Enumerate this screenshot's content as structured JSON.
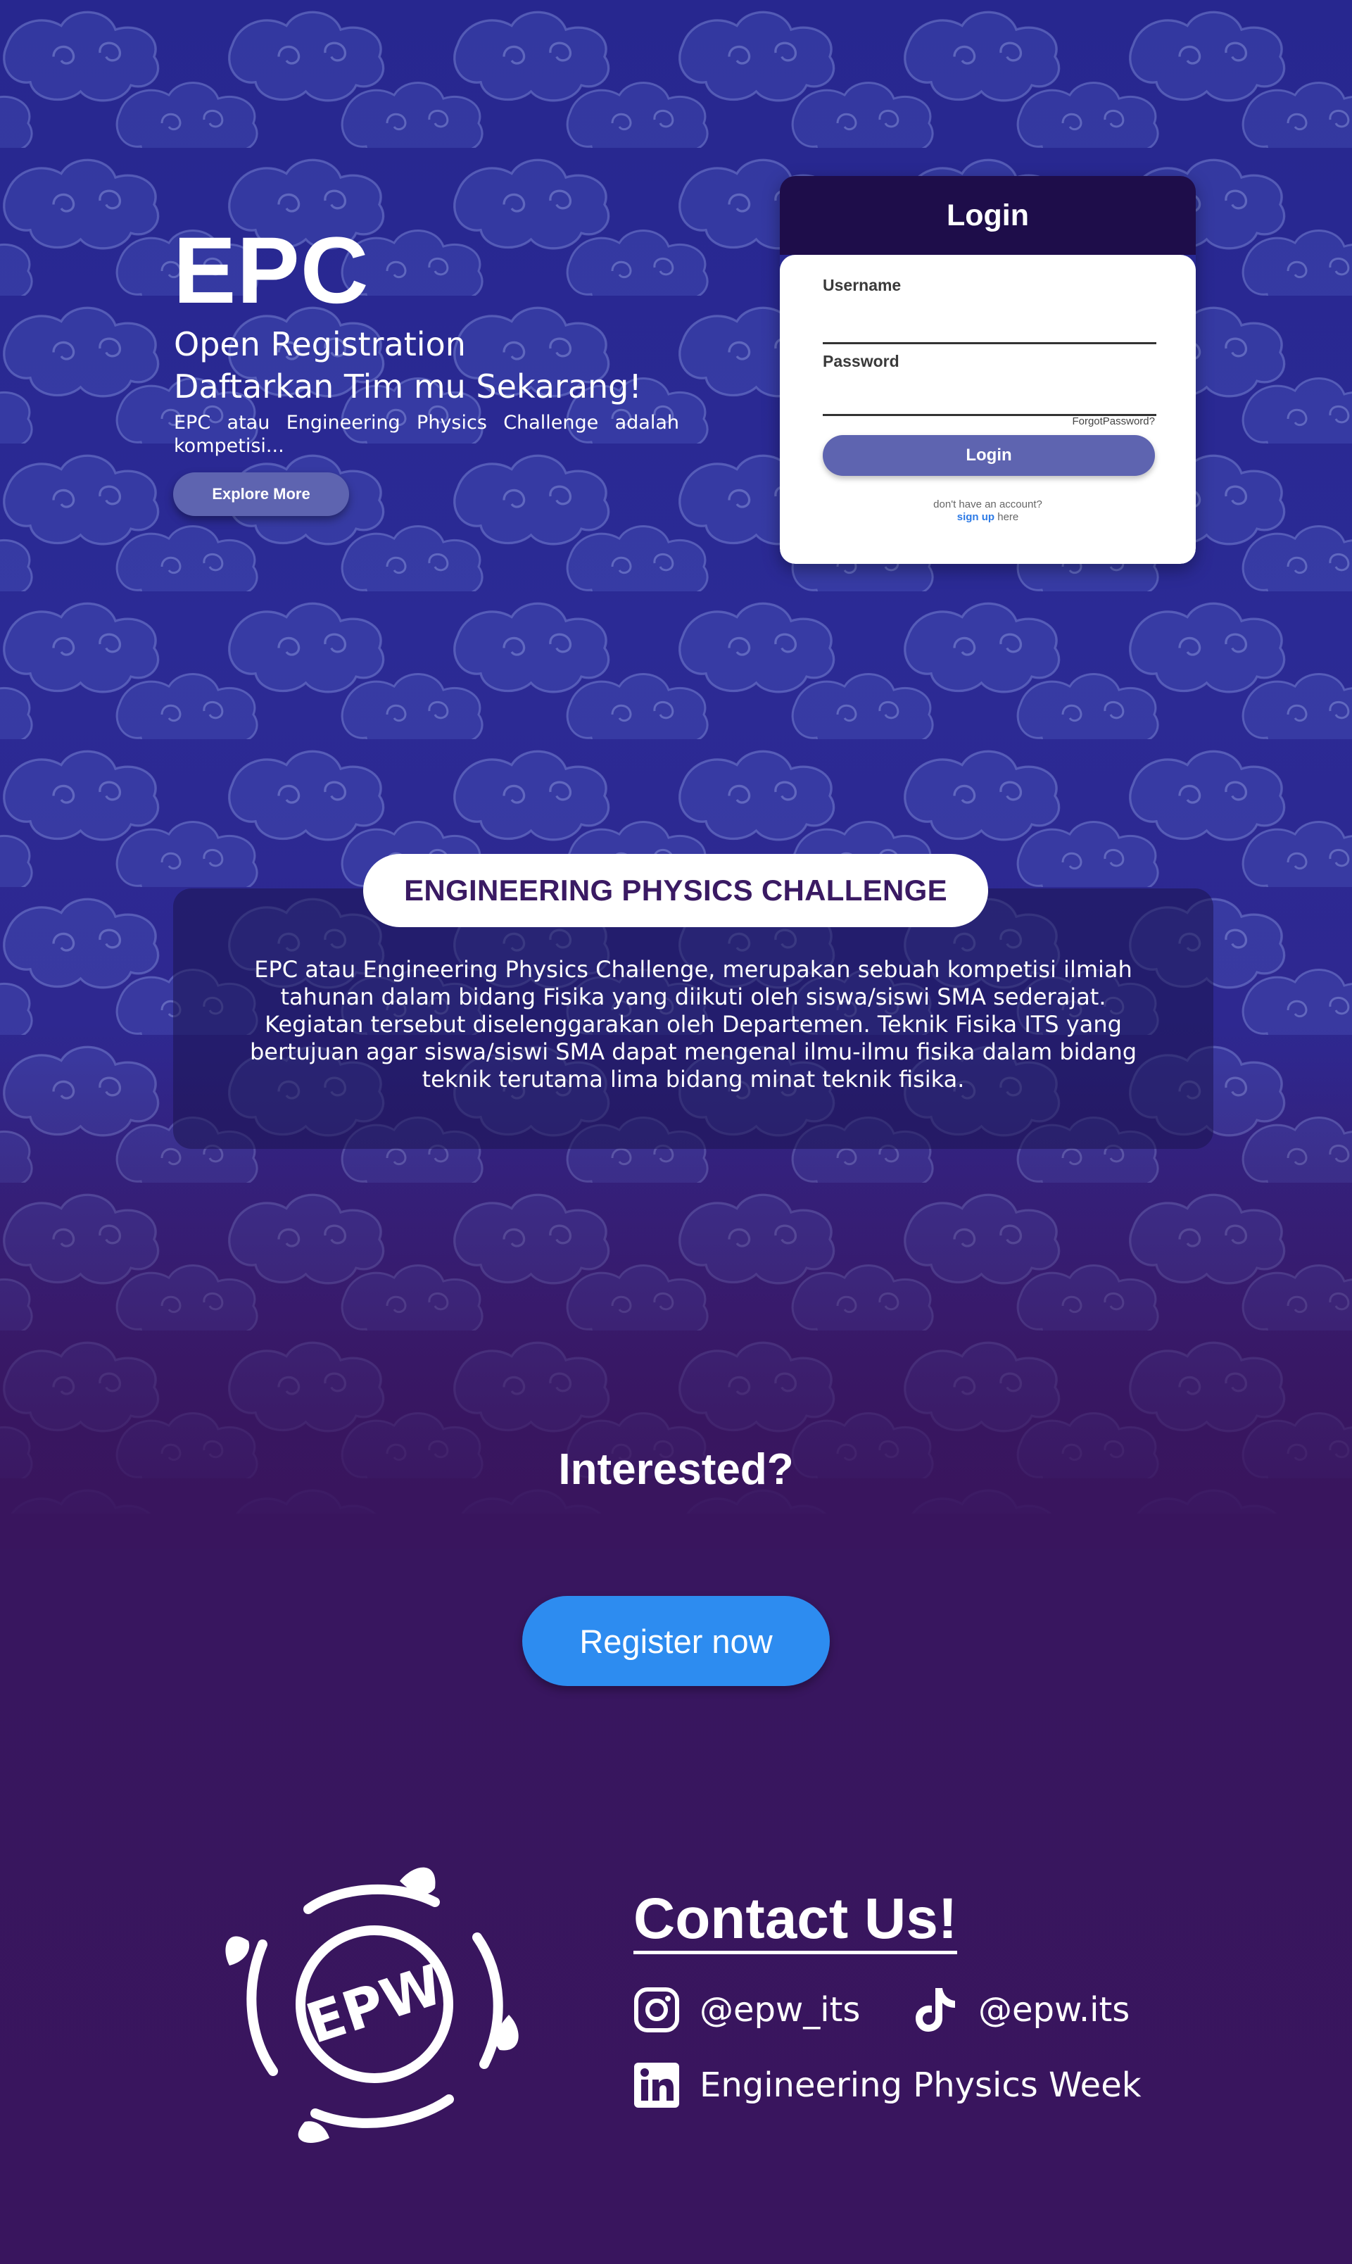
{
  "hero": {
    "title": "EPC",
    "subtitle_1": "Open Registration",
    "subtitle_2": "Daftarkan Tim mu Sekarang!",
    "description": "EPC atau Engineering Physics Challenge adalah kompetisi...",
    "explore_label": "Explore More"
  },
  "login": {
    "title": "Login",
    "username_label": "Username",
    "username_value": "",
    "password_label": "Password",
    "password_value": "",
    "forgot_label": "ForgotPassword?",
    "submit_label": "Login",
    "no_account_text": "don't have an account?",
    "signup_label": "sign up",
    "signup_suffix": "here"
  },
  "about": {
    "heading": "ENGINEERING PHYSICS CHALLENGE",
    "body": "EPC atau Engineering Physics Challenge,  merupakan sebuah kompetisi ilmiah tahunan dalam bidang Fisika yang diikuti oleh siswa/siswi SMA sederajat. Kegiatan tersebut diselenggarakan oleh Departemen. Teknik Fisika ITS yang bertujuan agar siswa/siswi SMA dapat mengenal ilmu-ilmu fisika dalam bidang teknik terutama lima bidang minat teknik fisika."
  },
  "cta": {
    "question": "Interested?",
    "register_label": "Register now"
  },
  "footer": {
    "logo_text": "EPW",
    "contact_title": "Contact Us!",
    "instagram": "@epw_its",
    "tiktok": "@epw.its",
    "linkedin": "Engineering Physics Week"
  },
  "colors": {
    "bg_top": "#27278f",
    "bg_bottom": "#39155e",
    "login_header": "#1e0d4a",
    "button_primary": "#5e64b0",
    "register_button": "#2d8cf0",
    "heading_purple": "#3a1a63"
  },
  "icons": [
    "instagram-icon",
    "tiktok-icon",
    "linkedin-icon"
  ]
}
